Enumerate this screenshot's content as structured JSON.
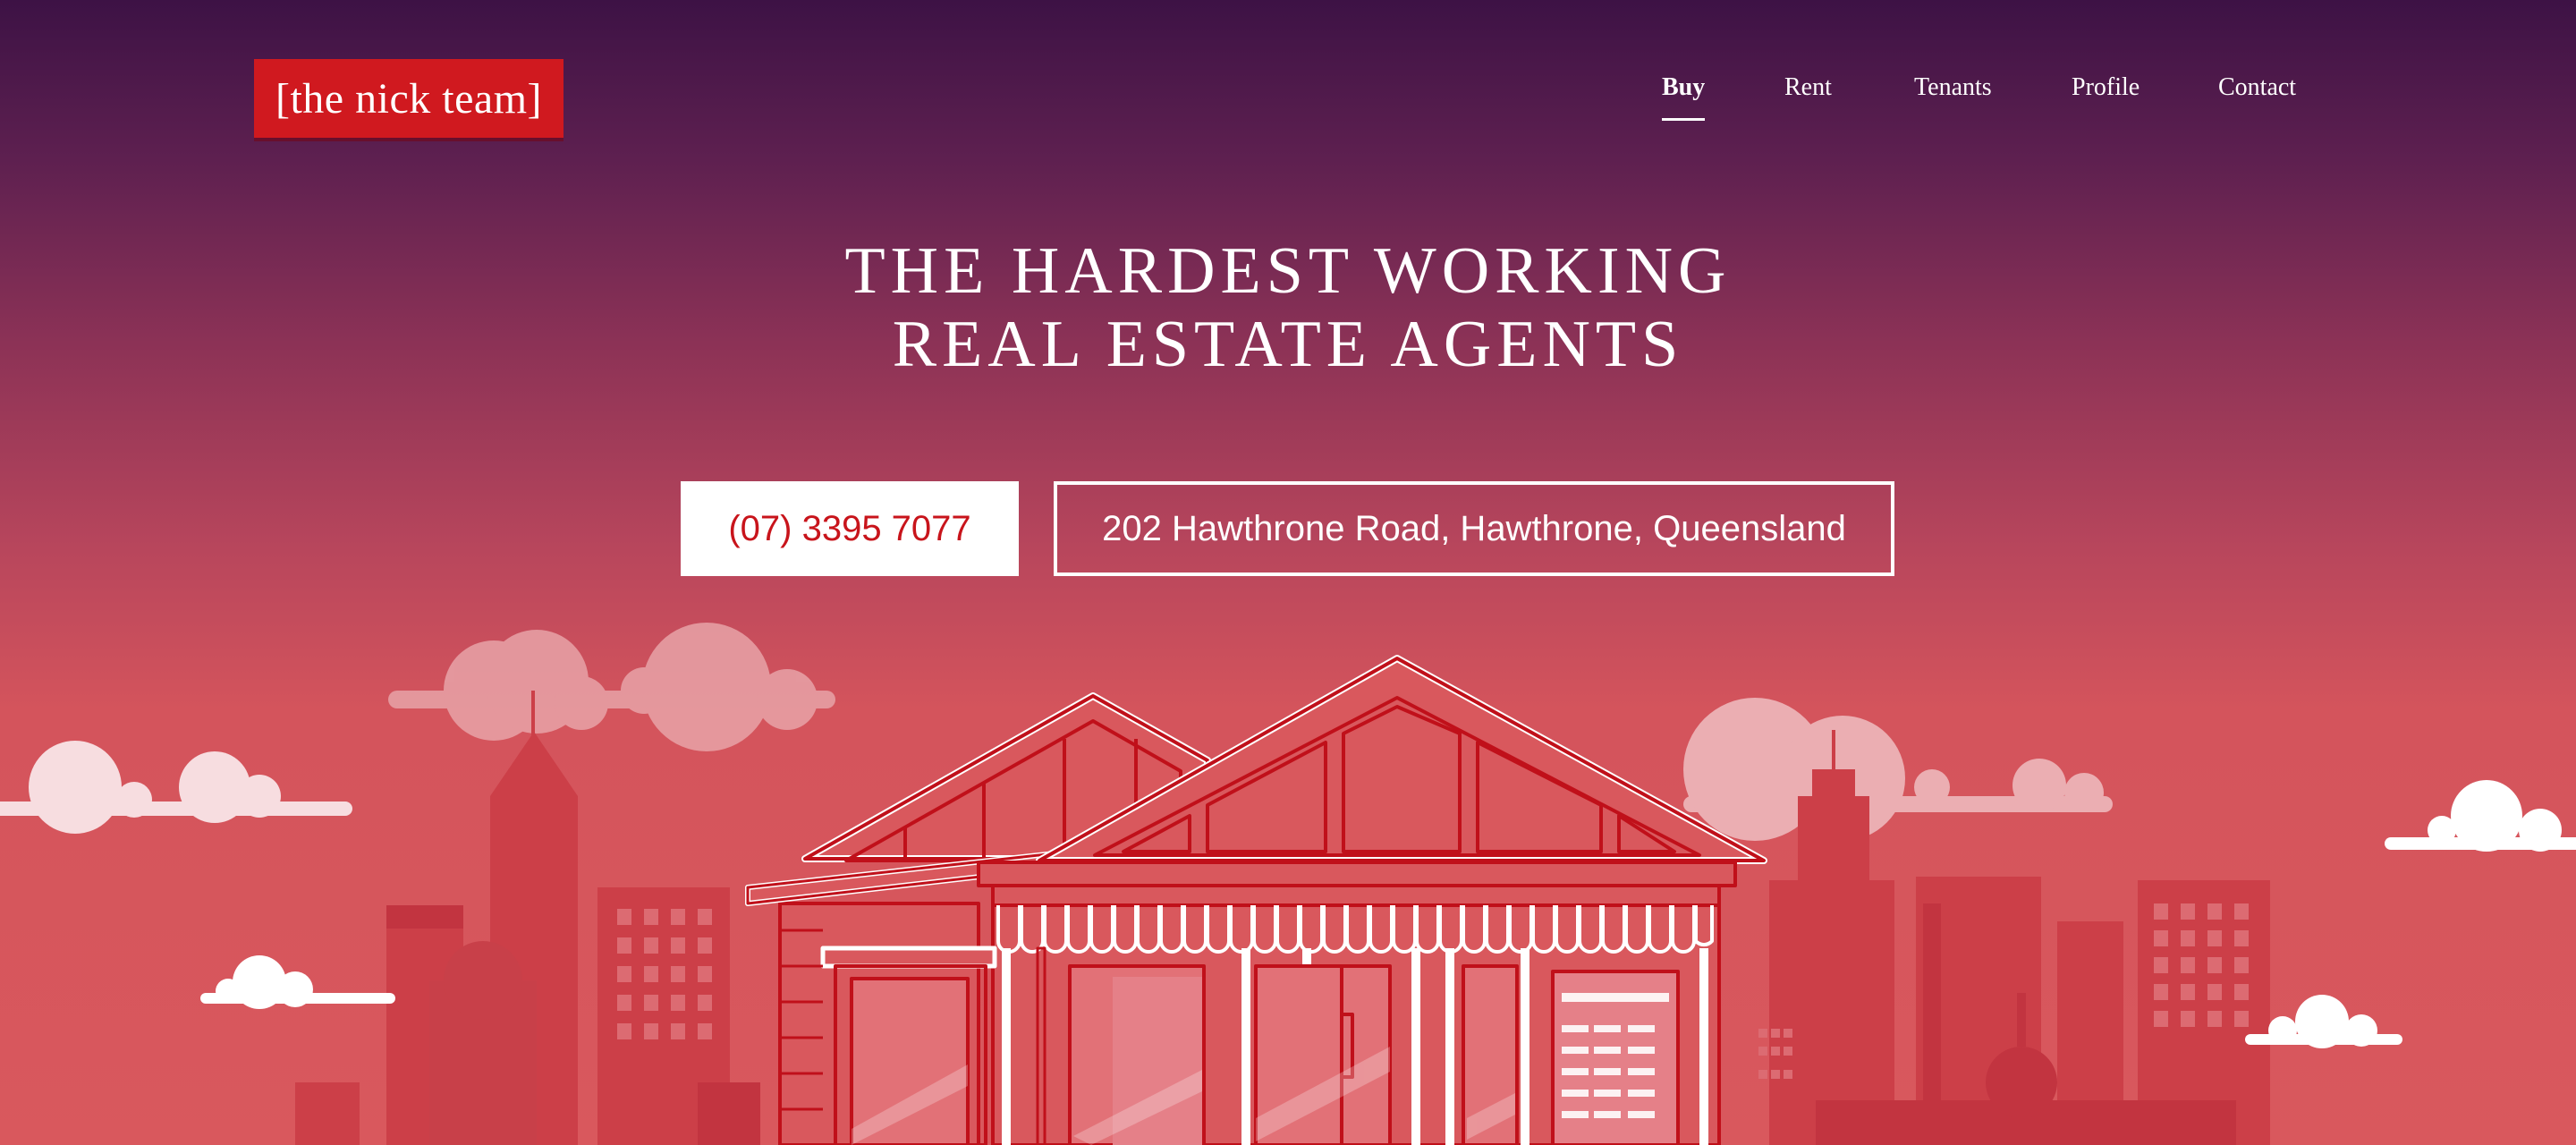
{
  "brand": {
    "logo_text": "[the nick team]"
  },
  "nav": {
    "items": [
      {
        "label": "Buy",
        "active": true
      },
      {
        "label": "Rent",
        "active": false
      },
      {
        "label": "Tenants",
        "active": false
      },
      {
        "label": "Profile",
        "active": false
      },
      {
        "label": "Contact",
        "active": false
      }
    ]
  },
  "hero": {
    "headline_line1": "THE HARDEST WORKING",
    "headline_line2": "REAL ESTATE AGENTS",
    "phone": "(07) 3395 7077",
    "address": "202 Hawthrone Road, Hawthrone, Queensland"
  },
  "colors": {
    "brand_red": "#d0191f",
    "sky_top": "#3d1245",
    "sky_bottom": "#d9585d",
    "house_line": "#c0101a",
    "skyline": "#cc3f48"
  }
}
